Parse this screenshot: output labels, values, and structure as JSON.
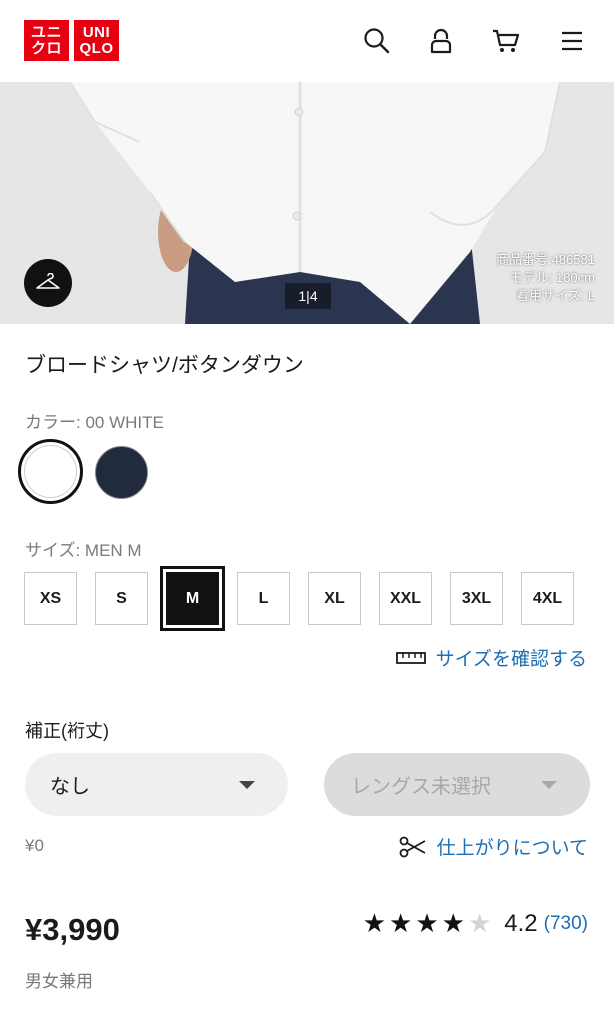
{
  "header": {
    "logo_top": "ユニクロ",
    "logo_top_l1": "ユニ",
    "logo_top_l2": "クロ",
    "logo_bottom_l1": "UNI",
    "logo_bottom_l2": "QLO",
    "icons": [
      "search-icon",
      "account-icon",
      "cart-icon",
      "menu-icon"
    ]
  },
  "hero": {
    "image_counter": "1|4",
    "product_number": "商品番号:486581",
    "model_height": "モデル: 180cm",
    "worn_size": "着用サイズ: L"
  },
  "product": {
    "title": "ブロードシャツ/ボタンダウン",
    "color_label": "カラー: 00 WHITE",
    "colors": [
      {
        "name": "white",
        "hex": "#ffffff",
        "selected": true
      },
      {
        "name": "navy",
        "hex": "#222a3e",
        "selected": false
      }
    ],
    "size_label": "サイズ: MEN M",
    "sizes": [
      {
        "label": "XS",
        "selected": false
      },
      {
        "label": "S",
        "selected": false
      },
      {
        "label": "M",
        "selected": true
      },
      {
        "label": "L",
        "selected": false
      },
      {
        "label": "XL",
        "selected": false
      },
      {
        "label": "XXL",
        "selected": false
      },
      {
        "label": "3XL",
        "selected": false
      },
      {
        "label": "4XL",
        "selected": false
      }
    ],
    "size_check_link": "サイズを確認する",
    "alteration_label": "補正(裄丈)",
    "alteration_select": "なし",
    "length_select": "レングス未選択",
    "alteration_price": "¥0",
    "finish_link": "仕上がりについて",
    "price": "¥3,990",
    "rating_value": "4.2",
    "rating_count": "(730)",
    "rating_stars_filled": 4,
    "rating_stars_total": 5,
    "gender": "男女兼用"
  },
  "colors": {
    "brand_red": "#e60012",
    "link_blue": "#1a6fb5",
    "text": "#1b1b1b",
    "muted": "#7a7a7a"
  }
}
